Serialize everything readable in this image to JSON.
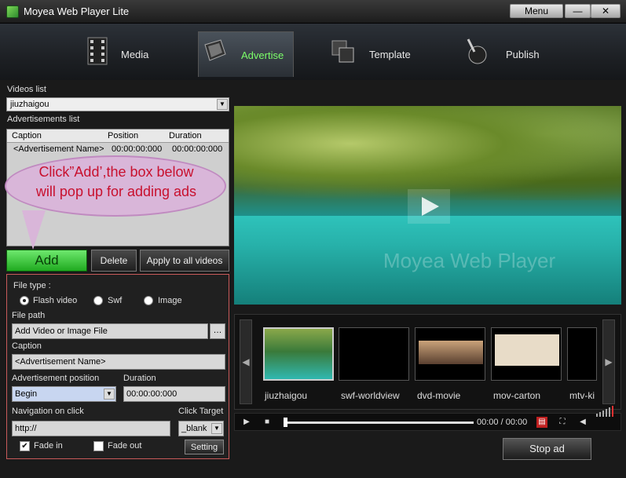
{
  "window": {
    "title": "Moyea Web Player Lite",
    "menu_label": "Menu",
    "min_label": "—",
    "close_label": "✕"
  },
  "nav": {
    "tabs": [
      {
        "label": "Media",
        "icon": "film-icon"
      },
      {
        "label": "Advertise",
        "icon": "advertise-icon",
        "active": true
      },
      {
        "label": "Template",
        "icon": "template-icon"
      },
      {
        "label": "Publish",
        "icon": "publish-icon"
      }
    ]
  },
  "videos_list": {
    "label": "Videos list",
    "selected": "jiuzhaigou"
  },
  "ads_list": {
    "label": "Advertisements  list",
    "columns": [
      "Caption",
      "Position",
      "Duration"
    ],
    "rows": [
      {
        "caption": "<Advertisement Name>",
        "position": "00:00:00:000",
        "duration": "00:00:00:000"
      }
    ]
  },
  "callout": {
    "line1": "Click”Add’,the box below",
    "line2": "will pop up for adding ads"
  },
  "buttons": {
    "add": "Add",
    "delete": "Delete",
    "apply_all": "Apply to all videos",
    "setting": "Setting",
    "stop_ad": "Stop ad"
  },
  "details": {
    "file_type_label": "File type :",
    "file_types": [
      "Flash video",
      "Swf",
      "Image"
    ],
    "file_path_label": "File path",
    "file_path_value": "Add Video or Image File",
    "browse_label": "…",
    "caption_label": "Caption",
    "caption_value": "<Advertisement Name>",
    "position_label": "Advertisement position",
    "position_value": "Begin",
    "duration_label": "Duration",
    "duration_value": "00:00:00:000",
    "nav_label": "Navigation on click",
    "nav_value": "http://",
    "target_label": "Click Target",
    "target_value": "_blank",
    "fade_in": "Fade in",
    "fade_out": "Fade out"
  },
  "video": {
    "watermark": "Moyea Web Player"
  },
  "playlist": {
    "items": [
      "jiuzhaigou",
      "swf-worldview",
      "dvd-movie",
      "mov-carton",
      "mtv-ki"
    ]
  },
  "controls": {
    "time": "00:00 / 00:00"
  }
}
